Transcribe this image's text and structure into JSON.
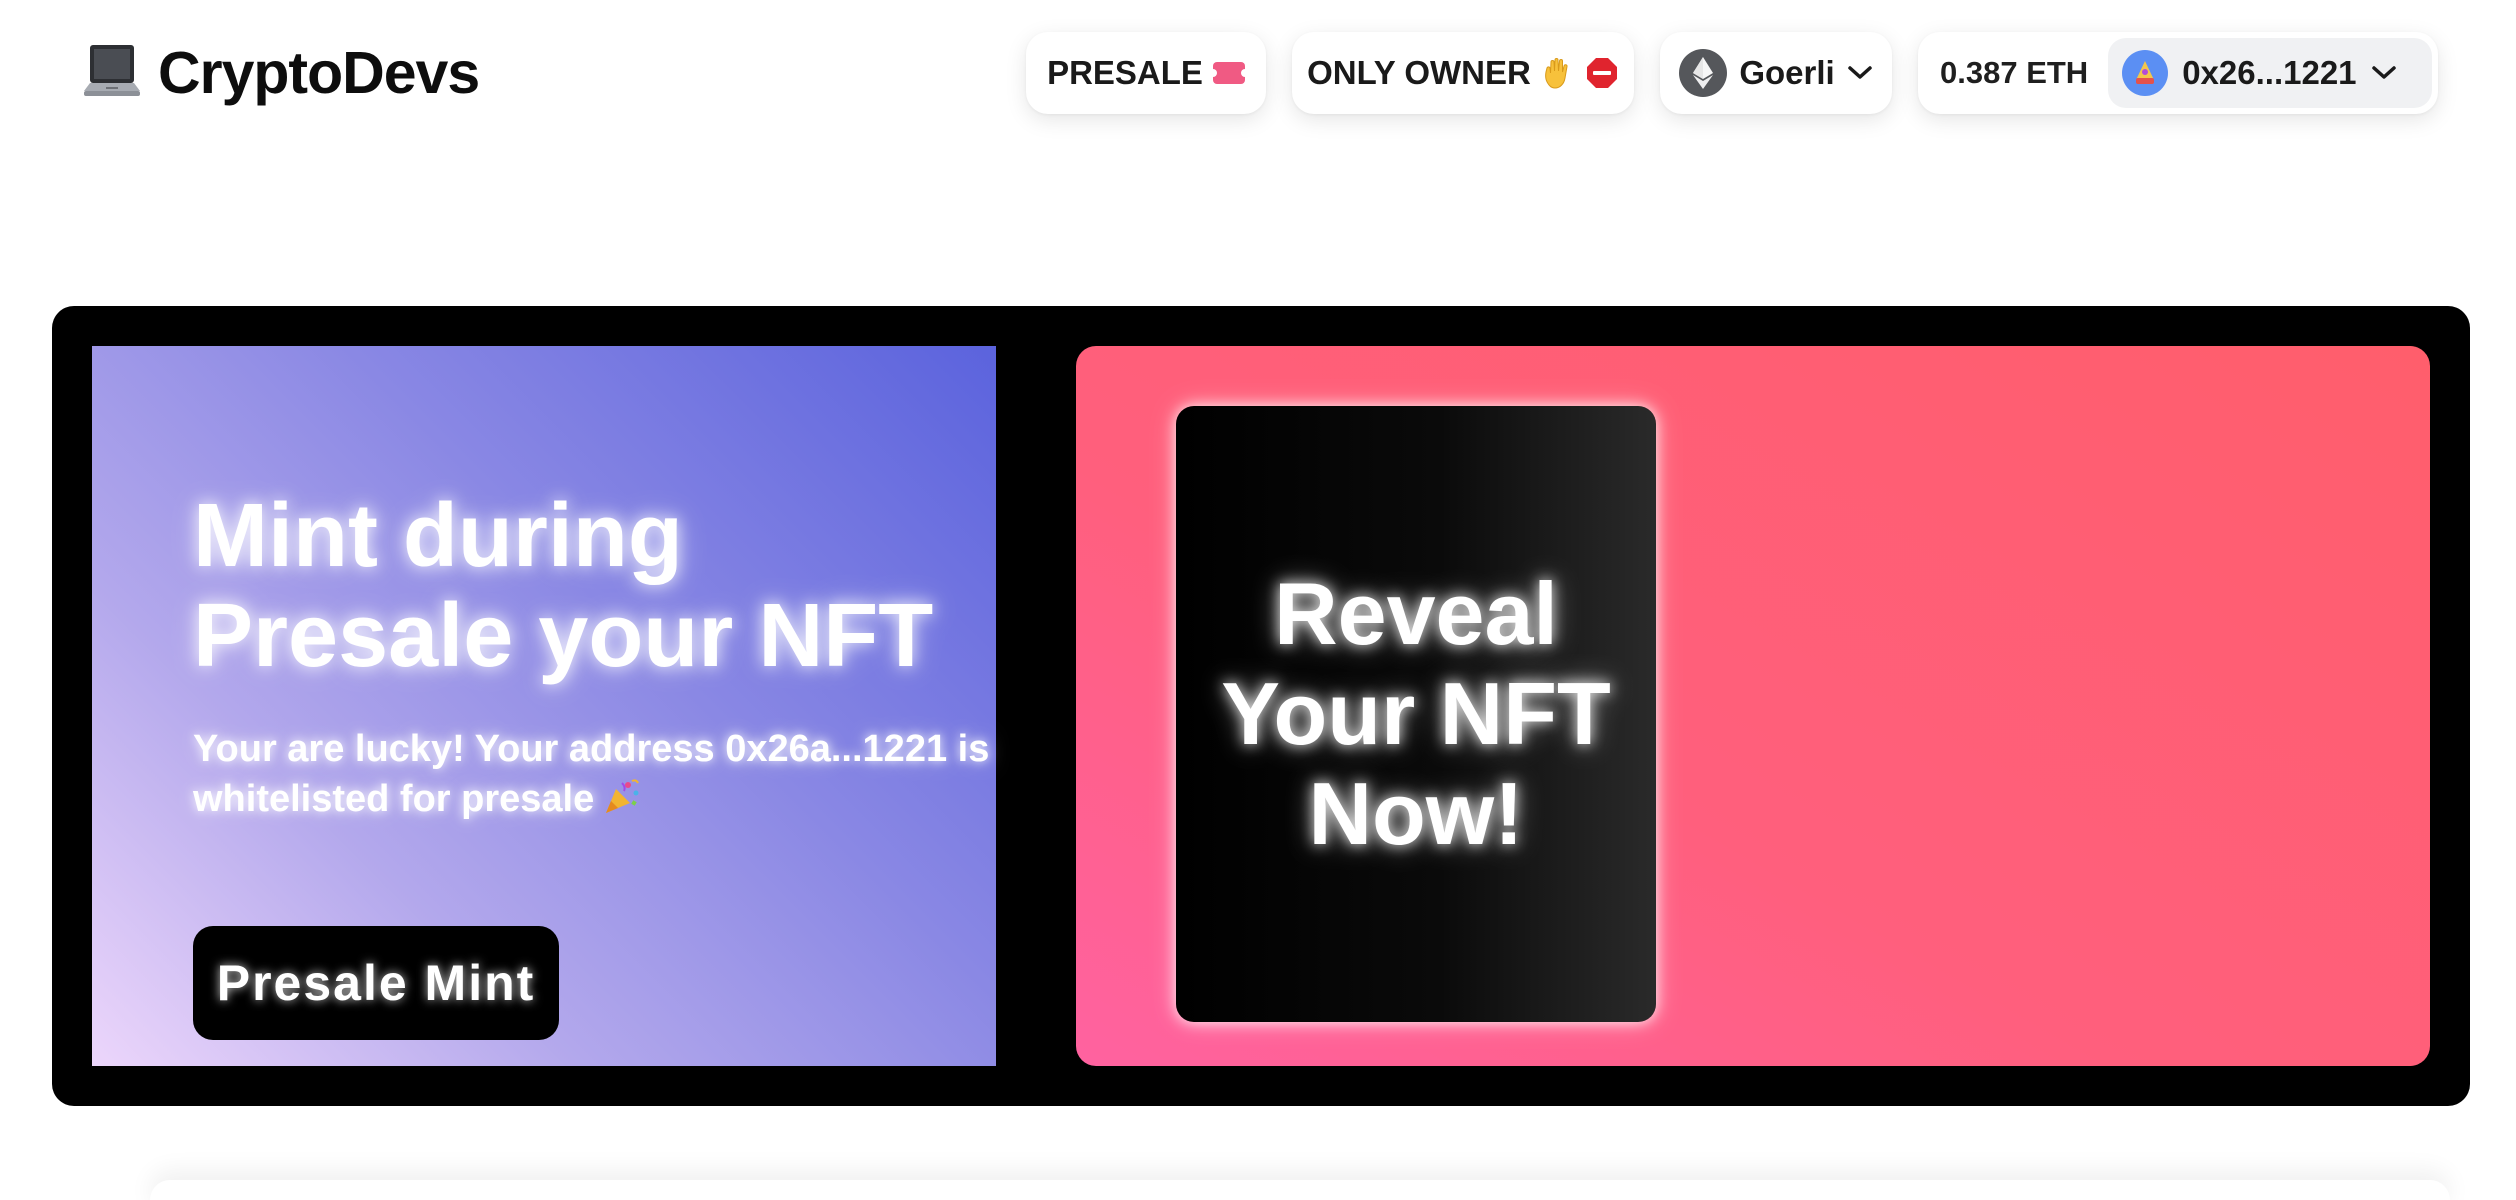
{
  "brand": {
    "name": "CryptoDevs",
    "icon": "laptop-icon"
  },
  "nav": {
    "presale": {
      "label": "PRESALE",
      "icon": "ticket-icon"
    },
    "only_owner": {
      "label": "ONLY OWNER",
      "icons": [
        "raised-hand-icon",
        "stop-sign-icon"
      ]
    },
    "network": {
      "label": "Goerli",
      "icon": "ethereum-icon"
    },
    "account": {
      "balance": "0.387 ETH",
      "address": "0x26...1221",
      "avatar": "wallet-avatar"
    }
  },
  "hero": {
    "mint_title": "Mint during Presale your NFT",
    "mint_subtitle": "Your are lucky! Your address 0x26a...1221 is whitelisted for presale",
    "mint_subtitle_icon": "party-popper-icon",
    "presale_button": "Presale Mint",
    "reveal_text": "Reveal Your NFT Now!"
  },
  "colors": {
    "left_gradient": [
      "#ecd6fb",
      "#5b63dd"
    ],
    "right_gradient": [
      "#ff62a0",
      "#ff5e6c"
    ],
    "hero_frame": "#000000"
  }
}
